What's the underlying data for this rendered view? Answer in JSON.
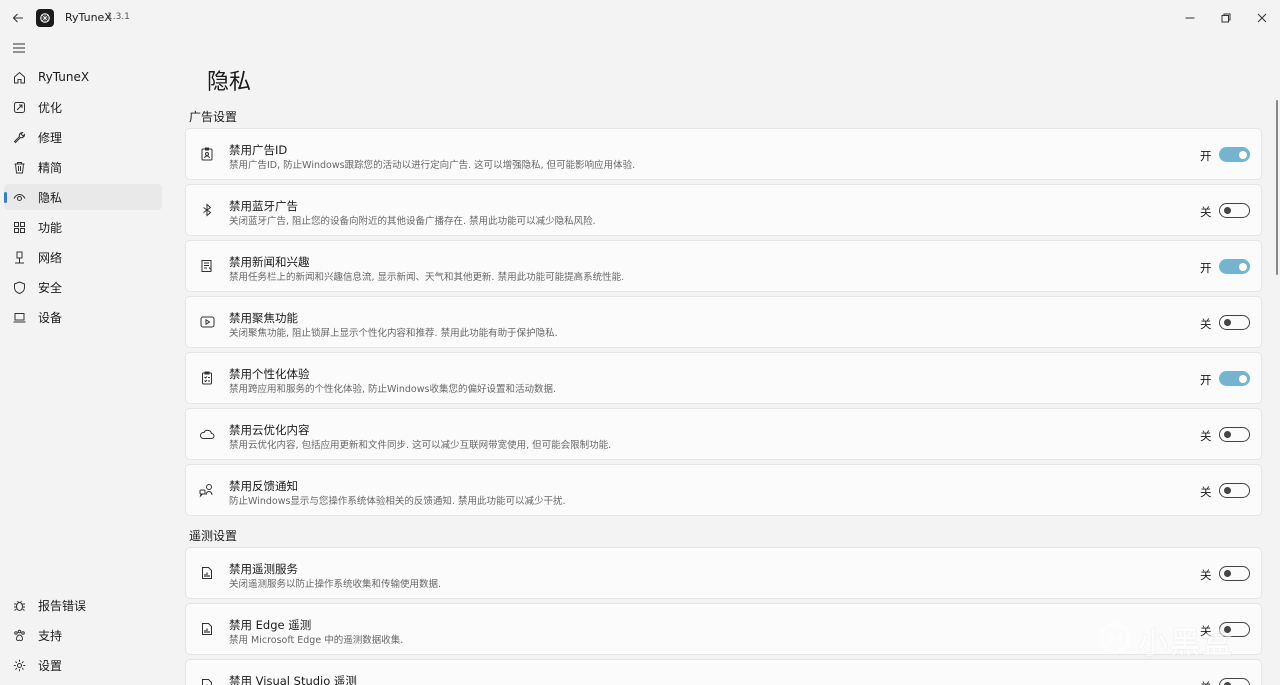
{
  "app": {
    "name": "RyTuneX",
    "version": "1.3.1"
  },
  "titlebar": {
    "back_icon": "arrow-left-icon",
    "logo_icon": "app-logo-icon",
    "minimize_icon": "minimize-icon",
    "restore_icon": "restore-icon",
    "close_icon": "close-icon"
  },
  "sidebar": {
    "menu_icon": "hamburger-icon",
    "items": [
      {
        "label": "RyTuneX",
        "icon": "home-icon",
        "active": false
      },
      {
        "label": "优化",
        "icon": "rocket-icon",
        "active": false
      },
      {
        "label": "修理",
        "icon": "wrench-icon",
        "active": false
      },
      {
        "label": "精简",
        "icon": "trash-icon",
        "active": false
      },
      {
        "label": "隐私",
        "icon": "eye-icon",
        "active": true
      },
      {
        "label": "功能",
        "icon": "apps-icon",
        "active": false
      },
      {
        "label": "网络",
        "icon": "network-icon",
        "active": false
      },
      {
        "label": "安全",
        "icon": "shield-icon",
        "active": false
      },
      {
        "label": "设备",
        "icon": "laptop-icon",
        "active": false
      }
    ],
    "bottom_items": [
      {
        "label": "报告错误",
        "icon": "bug-icon"
      },
      {
        "label": "支持",
        "icon": "paw-icon"
      },
      {
        "label": "设置",
        "icon": "gear-icon"
      }
    ]
  },
  "page": {
    "title": "隐私"
  },
  "sections": [
    {
      "title": "广告设置",
      "items": [
        {
          "title": "禁用广告ID",
          "desc": "禁用广告ID, 防止Windows跟踪您的活动以进行定向广告. 这可以增强隐私, 但可能影响应用体验.",
          "state": "开",
          "on": true,
          "icon": "badge-icon"
        },
        {
          "title": "禁用蓝牙广告",
          "desc": "关闭蓝牙广告, 阻止您的设备向附近的其他设备广播存在. 禁用此功能可以减少隐私风险.",
          "state": "关",
          "on": false,
          "icon": "bluetooth-icon"
        },
        {
          "title": "禁用新闻和兴趣",
          "desc": "禁用任务栏上的新闻和兴趣信息流, 显示新闻、天气和其他更新. 禁用此功能可能提高系统性能.",
          "state": "开",
          "on": true,
          "icon": "news-icon"
        },
        {
          "title": "禁用聚焦功能",
          "desc": "关闭聚焦功能, 阻止锁屏上显示个性化内容和推荐. 禁用此功能有助于保护隐私.",
          "state": "关",
          "on": false,
          "icon": "spotlight-icon"
        },
        {
          "title": "禁用个性化体验",
          "desc": "禁用跨应用和服务的个性化体验, 防止Windows收集您的偏好设置和活动数据.",
          "state": "开",
          "on": true,
          "icon": "clipboard-icon"
        },
        {
          "title": "禁用云优化内容",
          "desc": "禁用云优化内容, 包括应用更新和文件同步. 这可以减少互联网带宽使用, 但可能会限制功能.",
          "state": "关",
          "on": false,
          "icon": "cloud-icon"
        },
        {
          "title": "禁用反馈通知",
          "desc": "防止Windows显示与您操作系统体验相关的反馈通知. 禁用此功能可以减少干扰.",
          "state": "关",
          "on": false,
          "icon": "feedback-icon"
        }
      ]
    },
    {
      "title": "遥测设置",
      "items": [
        {
          "title": "禁用遥测服务",
          "desc": "关闭遥测服务以防止操作系统收集和传输使用数据.",
          "state": "关",
          "on": false,
          "icon": "telemetry-icon"
        },
        {
          "title": "禁用 Edge 遥测",
          "desc": "禁用 Microsoft Edge 中的遥测数据收集.",
          "state": "关",
          "on": false,
          "icon": "telemetry-icon"
        },
        {
          "title": "禁用 Visual Studio 遥测",
          "desc": "",
          "state": "关",
          "on": false,
          "icon": "telemetry-icon"
        }
      ]
    }
  ],
  "watermark": {
    "text": "小黑盒",
    "icon": "heybox-logo-icon"
  }
}
